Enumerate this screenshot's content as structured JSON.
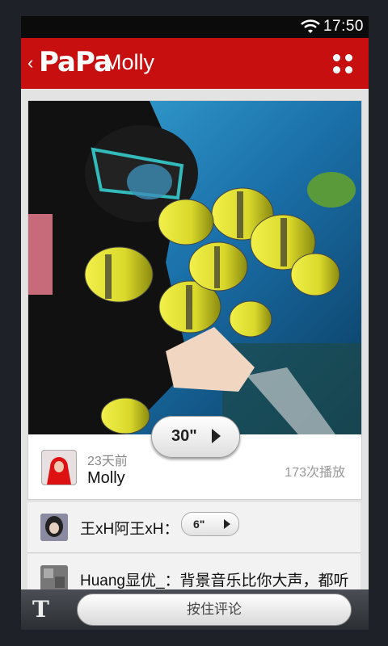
{
  "status_bar": {
    "time": "17:50",
    "wifi_icon": "wifi-icon"
  },
  "header": {
    "back_icon": "chevron-left-icon",
    "logo": "PaPa",
    "title": "Molly",
    "menu_icon": "grid-dots-icon"
  },
  "post": {
    "duration": "30\"",
    "time_ago": "23天前",
    "author": "Molly",
    "plays": "173次播放"
  },
  "comments": [
    {
      "author": "王xH阿王xH：",
      "voice_duration": "6\""
    },
    {
      "text": "Huang显优_：背景音乐比你大声，都听"
    }
  ],
  "bottom_bar": {
    "text_icon": "T",
    "hold_label": "按住评论"
  },
  "colors": {
    "brand_red": "#c70f0f",
    "background": "#e3e3e3"
  }
}
